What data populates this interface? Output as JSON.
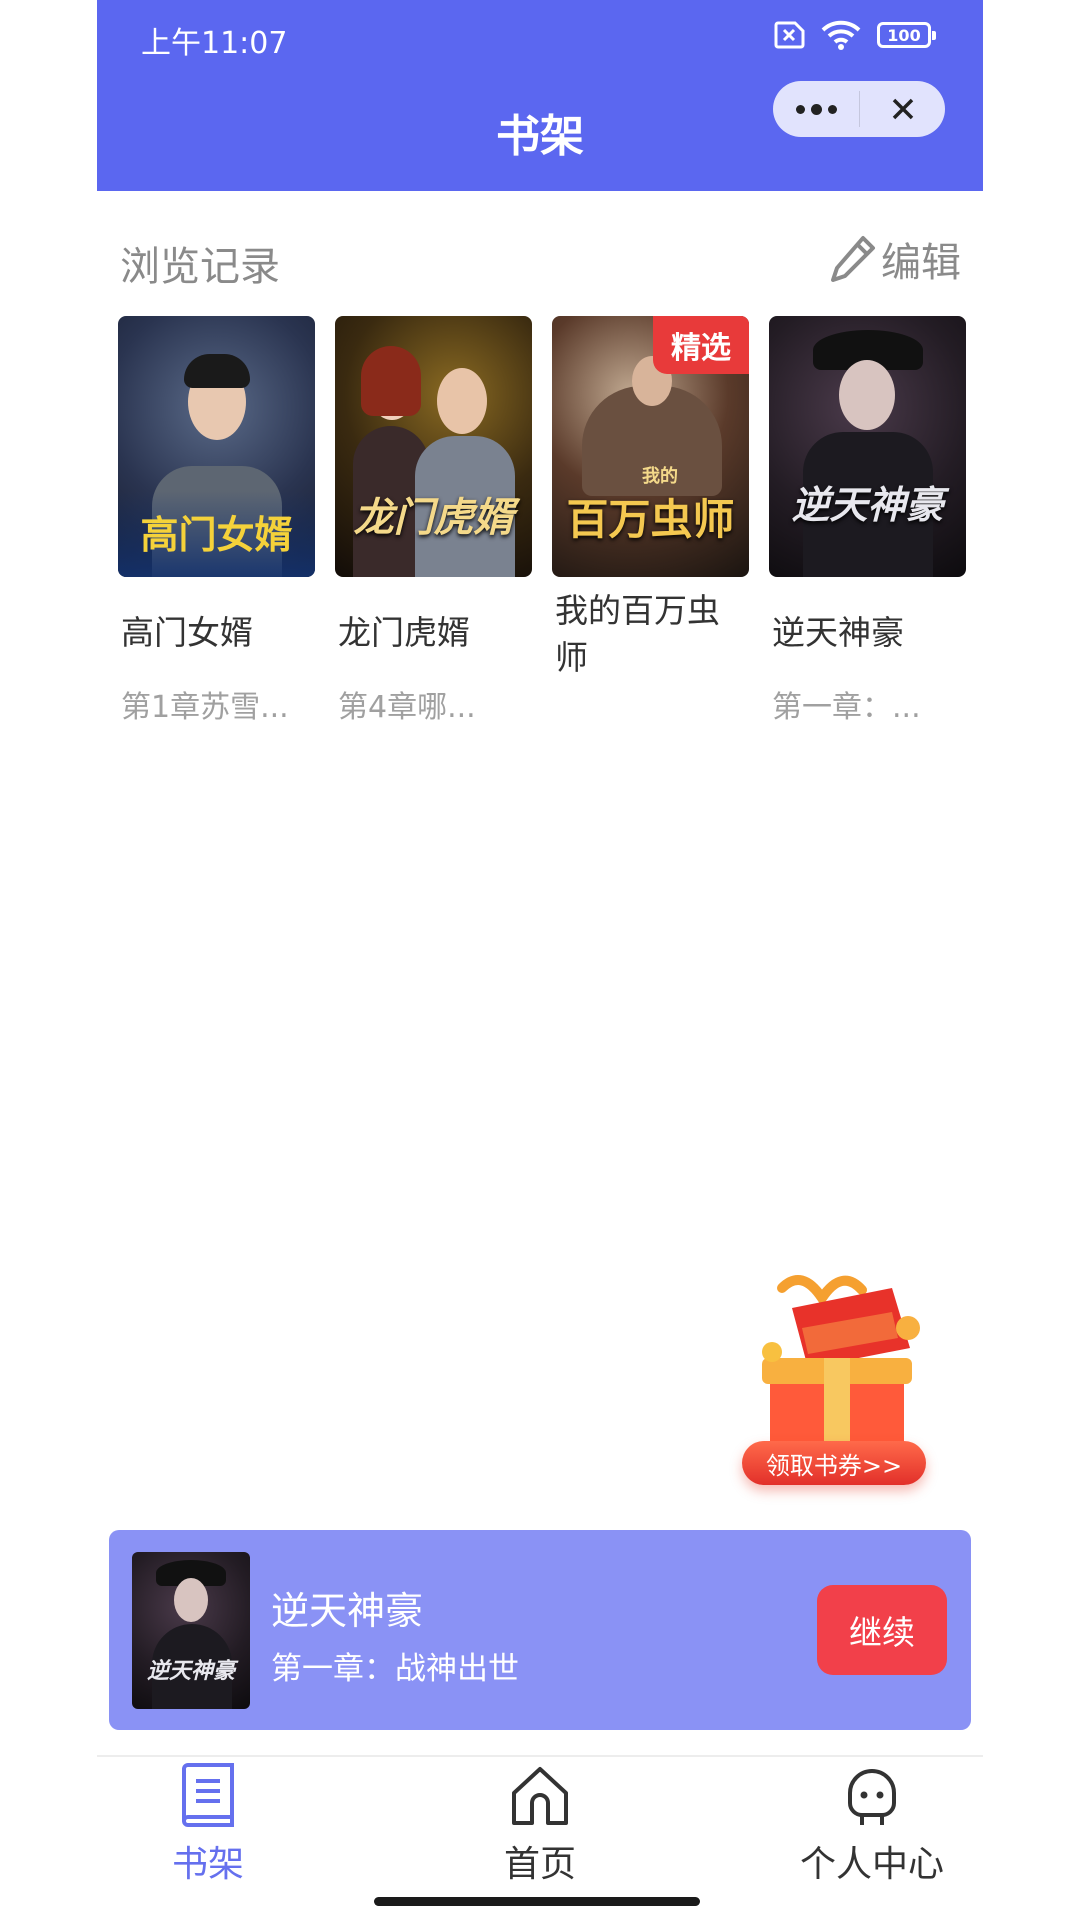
{
  "status_bar": {
    "time": "上午11:07",
    "battery": "100"
  },
  "header": {
    "title": "书架",
    "more_icon": "more-dots-icon",
    "close_icon": "close-icon",
    "color": "#5b67f0"
  },
  "history": {
    "title": "浏览记录",
    "edit_label": "编辑",
    "books": [
      {
        "name": "高门女婿",
        "chapter": "第1章苏雪...",
        "cover_text": "高门女婿",
        "badge": ""
      },
      {
        "name": "龙门虎婿",
        "chapter": "第4章哪...",
        "cover_text": "龙门虎婿",
        "badge": ""
      },
      {
        "name": "我的百万虫师",
        "chapter": "",
        "cover_text": "百万虫师",
        "cover_small": "我的",
        "badge": "精选"
      },
      {
        "name": "逆天神豪",
        "chapter": "第一章：...",
        "cover_text": "逆天神豪",
        "badge": ""
      }
    ]
  },
  "gift": {
    "label": "领取书券>>"
  },
  "continue_reading": {
    "title": "逆天神豪",
    "chapter": "第一章：战神出世",
    "button": "继续",
    "cover_text": "逆天神豪",
    "color": "#8a92f5",
    "button_color": "#f2404a"
  },
  "tabbar": {
    "tabs": [
      {
        "label": "书架",
        "icon": "book-icon",
        "active": true
      },
      {
        "label": "首页",
        "icon": "home-icon",
        "active": false
      },
      {
        "label": "个人中心",
        "icon": "profile-icon",
        "active": false
      }
    ],
    "active_color": "#6570ee"
  }
}
